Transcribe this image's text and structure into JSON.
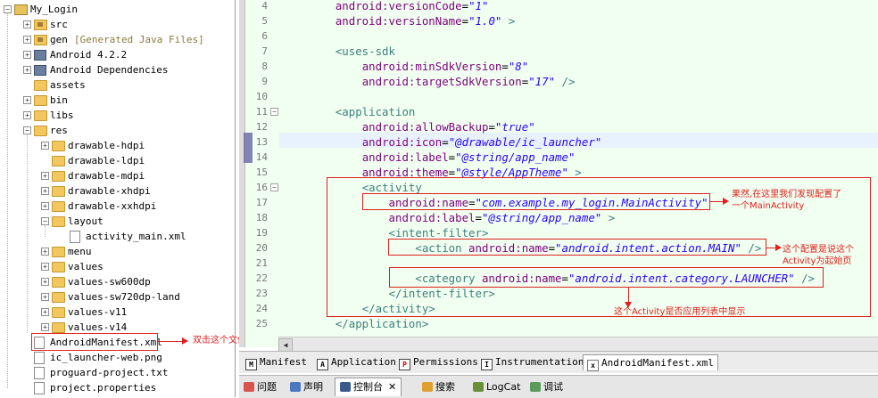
{
  "tree": {
    "items": [
      {
        "label": "My_Login",
        "note": ""
      },
      {
        "label": "src",
        "note": ""
      },
      {
        "label": "gen",
        "note": "[Generated Java Files]"
      },
      {
        "label": "Android 4.2.2",
        "note": ""
      },
      {
        "label": "Android Dependencies",
        "note": ""
      },
      {
        "label": "assets",
        "note": ""
      },
      {
        "label": "bin",
        "note": ""
      },
      {
        "label": "libs",
        "note": ""
      },
      {
        "label": "res",
        "note": ""
      },
      {
        "label": "drawable-hdpi",
        "note": ""
      },
      {
        "label": "drawable-ldpi",
        "note": ""
      },
      {
        "label": "drawable-mdpi",
        "note": ""
      },
      {
        "label": "drawable-xhdpi",
        "note": ""
      },
      {
        "label": "drawable-xxhdpi",
        "note": ""
      },
      {
        "label": "layout",
        "note": ""
      },
      {
        "label": "activity_main.xml",
        "note": ""
      },
      {
        "label": "menu",
        "note": ""
      },
      {
        "label": "values",
        "note": ""
      },
      {
        "label": "values-sw600dp",
        "note": ""
      },
      {
        "label": "values-sw720dp-land",
        "note": ""
      },
      {
        "label": "values-v11",
        "note": ""
      },
      {
        "label": "values-v14",
        "note": ""
      },
      {
        "label": "AndroidManifest.xml",
        "note": ""
      },
      {
        "label": "ic_launcher-web.png",
        "note": ""
      },
      {
        "label": "proguard-project.txt",
        "note": ""
      },
      {
        "label": "project.properties",
        "note": ""
      }
    ],
    "manifest_annotation": "双击这个文件"
  },
  "editor": {
    "lines": [
      {
        "n": "4",
        "parts": [
          [
            "    ",
            ""
          ],
          [
            "android:versionCode",
            "attr"
          ],
          [
            "=",
            "eq"
          ],
          [
            "\"1\"",
            "val"
          ]
        ]
      },
      {
        "n": "5",
        "parts": [
          [
            "    ",
            ""
          ],
          [
            "android:versionName",
            "attr"
          ],
          [
            "=",
            "eq"
          ],
          [
            "\"1.0\"",
            "val"
          ],
          [
            " >",
            "tag"
          ]
        ]
      },
      {
        "n": "6",
        "parts": []
      },
      {
        "n": "7",
        "parts": [
          [
            "    ",
            ""
          ],
          [
            "<uses-sdk",
            "tag"
          ]
        ]
      },
      {
        "n": "8",
        "parts": [
          [
            "        ",
            ""
          ],
          [
            "android:minSdkVersion",
            "attr"
          ],
          [
            "=",
            "eq"
          ],
          [
            "\"8\"",
            "val"
          ]
        ]
      },
      {
        "n": "9",
        "parts": [
          [
            "        ",
            ""
          ],
          [
            "android:targetSdkVersion",
            "attr"
          ],
          [
            "=",
            "eq"
          ],
          [
            "\"17\"",
            "val"
          ],
          [
            " />",
            "tag"
          ]
        ]
      },
      {
        "n": "10",
        "parts": []
      },
      {
        "n": "11",
        "parts": [
          [
            "    ",
            ""
          ],
          [
            "<application",
            "tag"
          ]
        ]
      },
      {
        "n": "12",
        "parts": [
          [
            "        ",
            ""
          ],
          [
            "android:allowBackup",
            "attr"
          ],
          [
            "=",
            "eq"
          ],
          [
            "\"true\"",
            "val"
          ]
        ]
      },
      {
        "n": "13",
        "parts": [
          [
            "        ",
            ""
          ],
          [
            "android:icon",
            "attr"
          ],
          [
            "=",
            "eq"
          ],
          [
            "\"@drawable/ic_launcher\"",
            "val"
          ]
        ]
      },
      {
        "n": "14",
        "parts": [
          [
            "        ",
            ""
          ],
          [
            "android:label",
            "attr"
          ],
          [
            "=",
            "eq"
          ],
          [
            "\"@string/app_name\"",
            "val"
          ]
        ]
      },
      {
        "n": "15",
        "parts": [
          [
            "        ",
            ""
          ],
          [
            "android:theme",
            "attr"
          ],
          [
            "=",
            "eq"
          ],
          [
            "\"@style/AppTheme\"",
            "val"
          ],
          [
            " >",
            "tag"
          ]
        ]
      },
      {
        "n": "16",
        "parts": [
          [
            "        ",
            ""
          ],
          [
            "<activity",
            "tag"
          ]
        ]
      },
      {
        "n": "17",
        "parts": [
          [
            "            ",
            ""
          ],
          [
            "android:name",
            "attr"
          ],
          [
            "=",
            "eq"
          ],
          [
            "\"com.example.my_login.MainActivity\"",
            "val"
          ]
        ]
      },
      {
        "n": "18",
        "parts": [
          [
            "            ",
            ""
          ],
          [
            "android:label",
            "attr"
          ],
          [
            "=",
            "eq"
          ],
          [
            "\"@string/app_name\"",
            "val"
          ],
          [
            " >",
            "tag"
          ]
        ]
      },
      {
        "n": "19",
        "parts": [
          [
            "            ",
            ""
          ],
          [
            "<intent-filter>",
            "tag"
          ]
        ]
      },
      {
        "n": "20",
        "parts": [
          [
            "                ",
            ""
          ],
          [
            "<action ",
            "tag"
          ],
          [
            "android:name",
            "attr"
          ],
          [
            "=",
            "eq"
          ],
          [
            "\"android.intent.action.MAIN\"",
            "val"
          ],
          [
            " />",
            "tag"
          ]
        ]
      },
      {
        "n": "21",
        "parts": []
      },
      {
        "n": "22",
        "parts": [
          [
            "                ",
            ""
          ],
          [
            "<category ",
            "tag"
          ],
          [
            "android:name",
            "attr"
          ],
          [
            "=",
            "eq"
          ],
          [
            "\"android.intent.category.LAUNCHER\"",
            "val"
          ],
          [
            " />",
            "tag"
          ]
        ]
      },
      {
        "n": "23",
        "parts": [
          [
            "            ",
            ""
          ],
          [
            "</intent-filter>",
            "tag"
          ]
        ]
      },
      {
        "n": "24",
        "parts": [
          [
            "        ",
            ""
          ],
          [
            "</activity>",
            "tag"
          ]
        ]
      },
      {
        "n": "25",
        "parts": [
          [
            "    ",
            ""
          ],
          [
            "</application>",
            "tag"
          ]
        ]
      }
    ],
    "annotations": {
      "main_activity_1": "果然,在这里我们发现配置了",
      "main_activity_2": "一个MainActivity",
      "start_page_1": "这个配置是说这个",
      "start_page_2": "Activity为起始页",
      "launcher": "这个Activity是否应用列表中显示"
    }
  },
  "editor_tabs": {
    "manifest": "Manifest",
    "application": "Application",
    "permissions": "Permissions",
    "instrumentation": "Instrumentation",
    "source": "AndroidManifest.xml"
  },
  "view_tabs": {
    "problems": "问题",
    "javadoc": "声明",
    "console": "控制台",
    "search": "搜索",
    "logcat": "LogCat",
    "debug": "调试"
  }
}
